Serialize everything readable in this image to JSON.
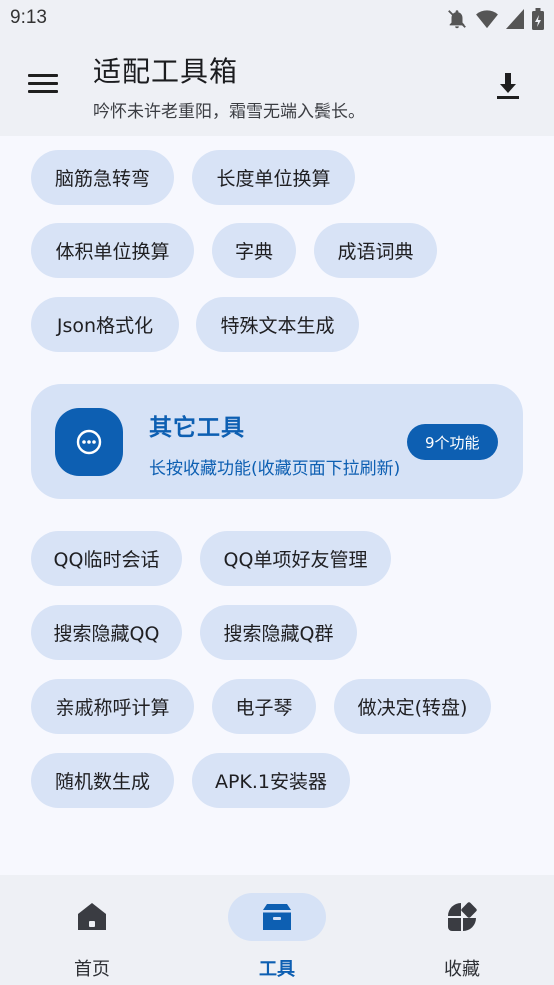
{
  "status_bar": {
    "time": "9:13",
    "icons": [
      "notifications-off-icon",
      "wifi-icon",
      "signal-icon",
      "battery-charging-icon"
    ]
  },
  "app_bar": {
    "title": "适配工具箱",
    "subtitle": "吟怀未许老重阳，霜雪无端入鬓长。",
    "menu_icon": "menu-icon",
    "action_icon": "download-icon"
  },
  "top_chips": [
    "脑筋急转弯",
    "长度单位换算",
    "体积单位换算",
    "字典",
    "成语词典",
    "Json格式化",
    "特殊文本生成"
  ],
  "group": {
    "title": "其它工具",
    "description": "长按收藏功能(收藏页面下拉刷新)",
    "badge": "9个功能",
    "icon": "more-horizontal-icon",
    "chips": [
      "QQ临时会话",
      "QQ单项好友管理",
      "搜索隐藏QQ",
      "搜索隐藏Q群",
      "亲戚称呼计算",
      "电子琴",
      "做决定(转盘)",
      "随机数生成",
      "APK.1安装器"
    ]
  },
  "bottom_nav": [
    {
      "label": "首页",
      "icon": "home-icon",
      "active": false
    },
    {
      "label": "工具",
      "icon": "toolbox-icon",
      "active": true
    },
    {
      "label": "收藏",
      "icon": "favorites-icon",
      "active": false
    }
  ],
  "colors": {
    "accent": "#0d5fb2",
    "chip_bg": "#d8e3f6",
    "bar_bg": "#eef0f5",
    "page_bg": "#f7f8fe"
  }
}
